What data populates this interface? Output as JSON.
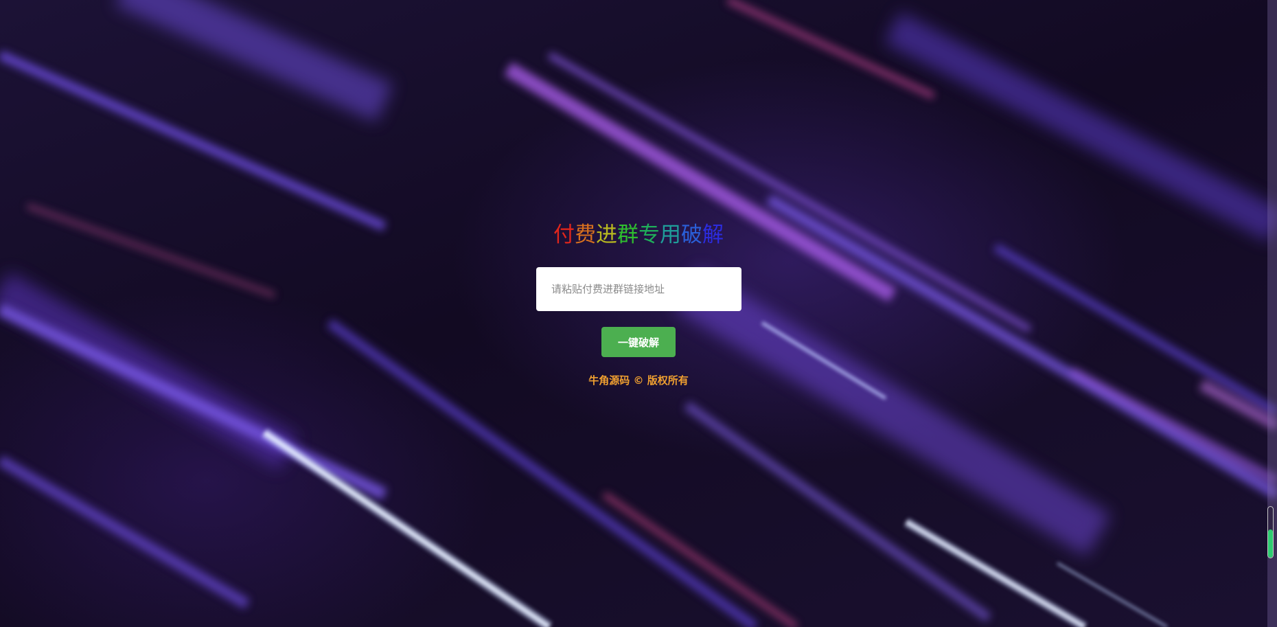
{
  "header": {
    "title_chars": [
      {
        "char": "付",
        "color": "#e0261c"
      },
      {
        "char": "费",
        "color": "#d8701e"
      },
      {
        "char": "进",
        "color": "#b8b820"
      },
      {
        "char": "群",
        "color": "#2fbf2f"
      },
      {
        "char": "专",
        "color": "#1fae5a"
      },
      {
        "char": "用",
        "color": "#1f9e9a"
      },
      {
        "char": "破",
        "color": "#2a5fd8"
      },
      {
        "char": "解",
        "color": "#2c2ce0"
      }
    ]
  },
  "form": {
    "url_placeholder": "请粘贴付费进群链接地址",
    "url_value": "",
    "submit_label": "一键破解"
  },
  "footer": {
    "copyright": "牛角源码 © 版权所有"
  },
  "side_indicator": {
    "fill_percent": 55,
    "fill_color": "#2ecc71"
  }
}
